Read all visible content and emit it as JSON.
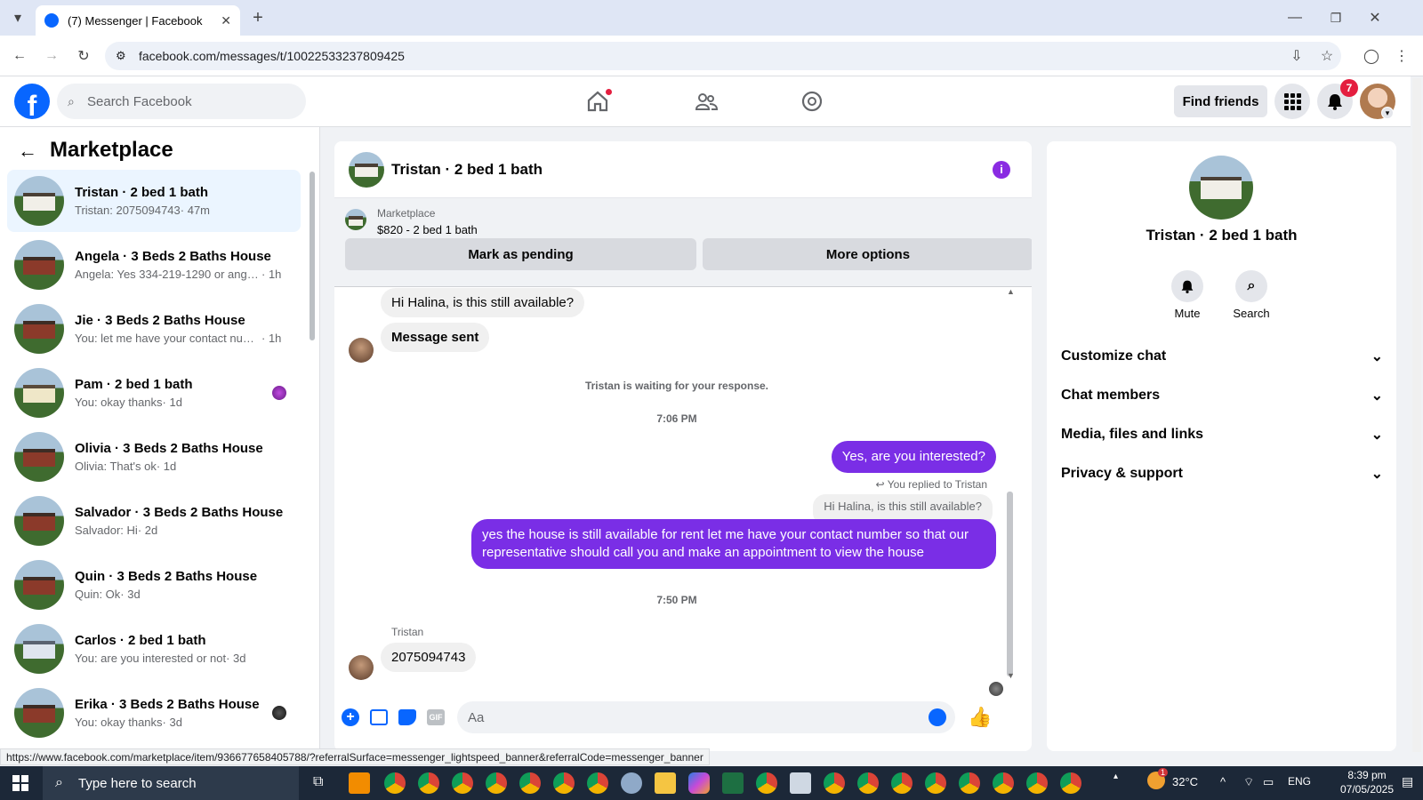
{
  "browser": {
    "tab_title": "(7) Messenger | Facebook",
    "url": "facebook.com/messages/t/10022533237809425",
    "status_url": "https://www.facebook.com/marketplace/item/936677658405788/?referralSurface=messenger_lightspeed_banner&referralCode=messenger_banner"
  },
  "fb": {
    "search_placeholder": "Search Facebook",
    "find_friends": "Find friends",
    "notification_count": "7"
  },
  "left": {
    "title": "Marketplace",
    "conversations": [
      {
        "title": "Tristan · 2 bed 1 bath",
        "snippet": "Tristan: 2075094743",
        "time": " · 47m"
      },
      {
        "title": "Angela · 3 Beds 2 Baths House",
        "snippet": "Angela: Yes 334-219-1290 or angel...",
        "time": " · 1h"
      },
      {
        "title": "Jie · 3 Beds 2 Baths House",
        "snippet": "You: let me have your contact num...",
        "time": " · 1h"
      },
      {
        "title": "Pam · 2 bed 1 bath",
        "snippet": "You: okay thanks",
        "time": " · 1d"
      },
      {
        "title": "Olivia · 3 Beds 2 Baths House",
        "snippet": "Olivia: That's ok",
        "time": " · 1d"
      },
      {
        "title": "Salvador · 3 Beds 2 Baths House",
        "snippet": "Salvador: Hi",
        "time": " · 2d"
      },
      {
        "title": "Quin · 3 Beds 2 Baths House",
        "snippet": "Quin: Ok",
        "time": " · 3d"
      },
      {
        "title": "Carlos · 2 bed 1 bath",
        "snippet": "You: are you interested or not",
        "time": " · 3d"
      },
      {
        "title": "Erika · 3 Beds 2 Baths House",
        "snippet": "You: okay thanks",
        "time": " · 3d"
      }
    ]
  },
  "chat": {
    "title": "Tristan · 2 bed 1 bath",
    "banner_label": "Marketplace",
    "banner_listing": "$820 - 2 bed 1 bath",
    "mark_pending": "Mark as pending",
    "more_options": "More options",
    "msg1": "Hi Halina, is this still available?",
    "msg2": "Message sent",
    "waiting": "Tristan is waiting for your response.",
    "time1": "7:06 PM",
    "out1": "Yes, are you interested?",
    "replied_label": "You replied to Tristan",
    "quoted": "Hi Halina, is this still available?",
    "out2": "yes the house is still available for rent let me have your contact number so that our representative should call you and make an appointment to view the house",
    "time2": "7:50 PM",
    "sender": "Tristan",
    "msg3": "2075094743",
    "composer_placeholder": "Aa",
    "gif_label": "GIF"
  },
  "right": {
    "title": "Tristan · 2 bed 1 bath",
    "mute": "Mute",
    "search": "Search",
    "rows": [
      "Customize chat",
      "Chat members",
      "Media, files and links",
      "Privacy & support"
    ]
  },
  "taskbar": {
    "search_placeholder": "Type here to search",
    "temp": "32°C",
    "lang": "ENG",
    "time": "8:39 pm",
    "date": "07/05/2025",
    "weather_badge": "1"
  },
  "colors": {
    "fb_blue": "#0866ff",
    "messenger_purple": "#7a2ee6",
    "accent_purple": "#8a2be2"
  }
}
